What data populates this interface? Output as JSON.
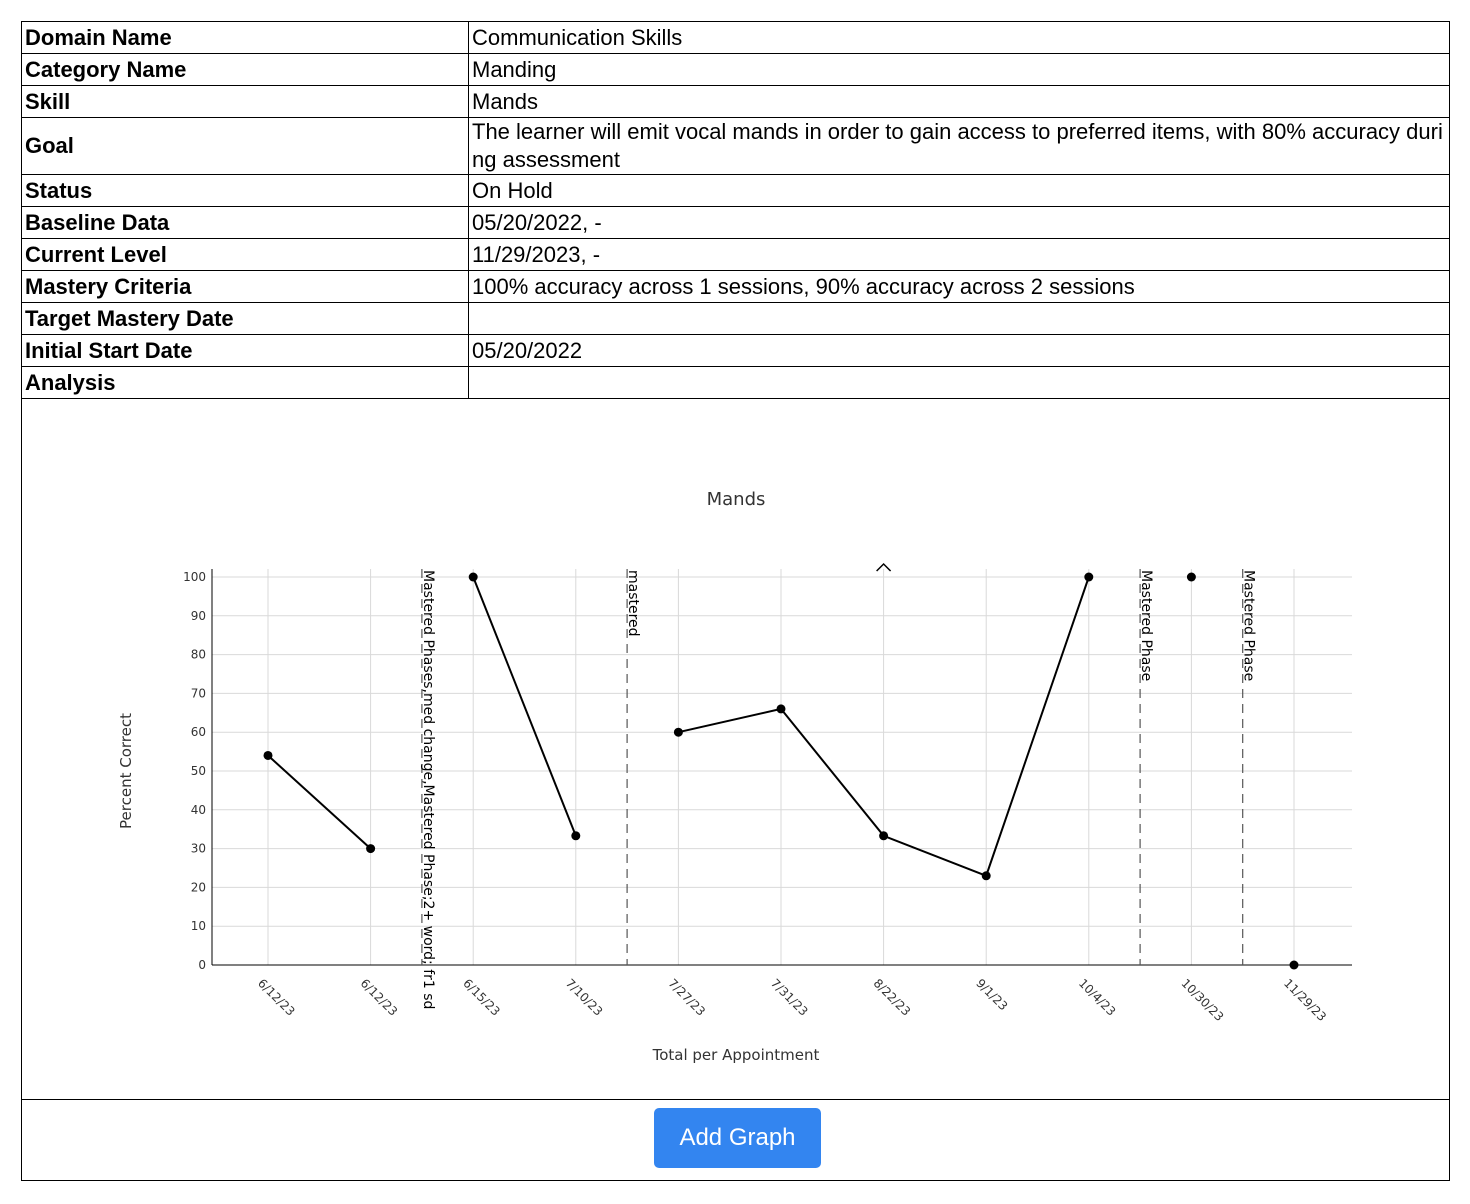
{
  "info_rows": [
    {
      "label": "Domain Name",
      "value": "Communication Skills"
    },
    {
      "label": "Category Name",
      "value": "Manding"
    },
    {
      "label": "Skill",
      "value": "Mands"
    },
    {
      "label": "Goal",
      "value": "The learner will emit vocal mands in order to gain access to preferred items, with 80% accuracy during assessment"
    },
    {
      "label": "Status",
      "value": "On Hold"
    },
    {
      "label": "Baseline Data",
      "value": "05/20/2022, -"
    },
    {
      "label": "Current Level",
      "value": "11/29/2023, -"
    },
    {
      "label": "Mastery Criteria",
      "value": "100% accuracy across 1 sessions, 90% accuracy across 2 sessions"
    },
    {
      "label": "Target Mastery Date",
      "value": ""
    },
    {
      "label": "Initial Start Date",
      "value": "05/20/2022"
    },
    {
      "label": "Analysis",
      "value": ""
    }
  ],
  "button": {
    "label": "Add Graph"
  },
  "chart_data": {
    "type": "line",
    "title": "Mands",
    "xlabel": "Total per Appointment",
    "ylabel": "Percent Correct",
    "ylim": [
      0,
      100
    ],
    "yticks": [
      0,
      10,
      20,
      30,
      40,
      50,
      60,
      70,
      80,
      90,
      100
    ],
    "categories": [
      "6/12/23",
      "6/12/23",
      "6/15/23",
      "7/10/23",
      "7/27/23",
      "7/31/23",
      "8/22/23",
      "9/1/23",
      "10/4/23",
      "10/30/23",
      "11/29/23"
    ],
    "series": [
      {
        "values": [
          54,
          30,
          100,
          33.3,
          60,
          66,
          33.3,
          23,
          100,
          100,
          0
        ]
      }
    ],
    "segment_breaks_after": [
      1,
      3,
      8,
      9
    ],
    "phase_lines": [
      {
        "after_index": 1,
        "label": "Mastered Phases,med change,Mastered Phase;2+ word; fr1 sd"
      },
      {
        "after_index": 3,
        "label": "mastered"
      },
      {
        "after_index": 8,
        "label": "Mastered Phase"
      },
      {
        "after_index": 9,
        "label": "Mastered Phase"
      }
    ],
    "annotation_marker": {
      "index": 6,
      "symbol": "^"
    },
    "grid": true,
    "line_color": "#000000",
    "grid_color": "#d9d9d9"
  }
}
